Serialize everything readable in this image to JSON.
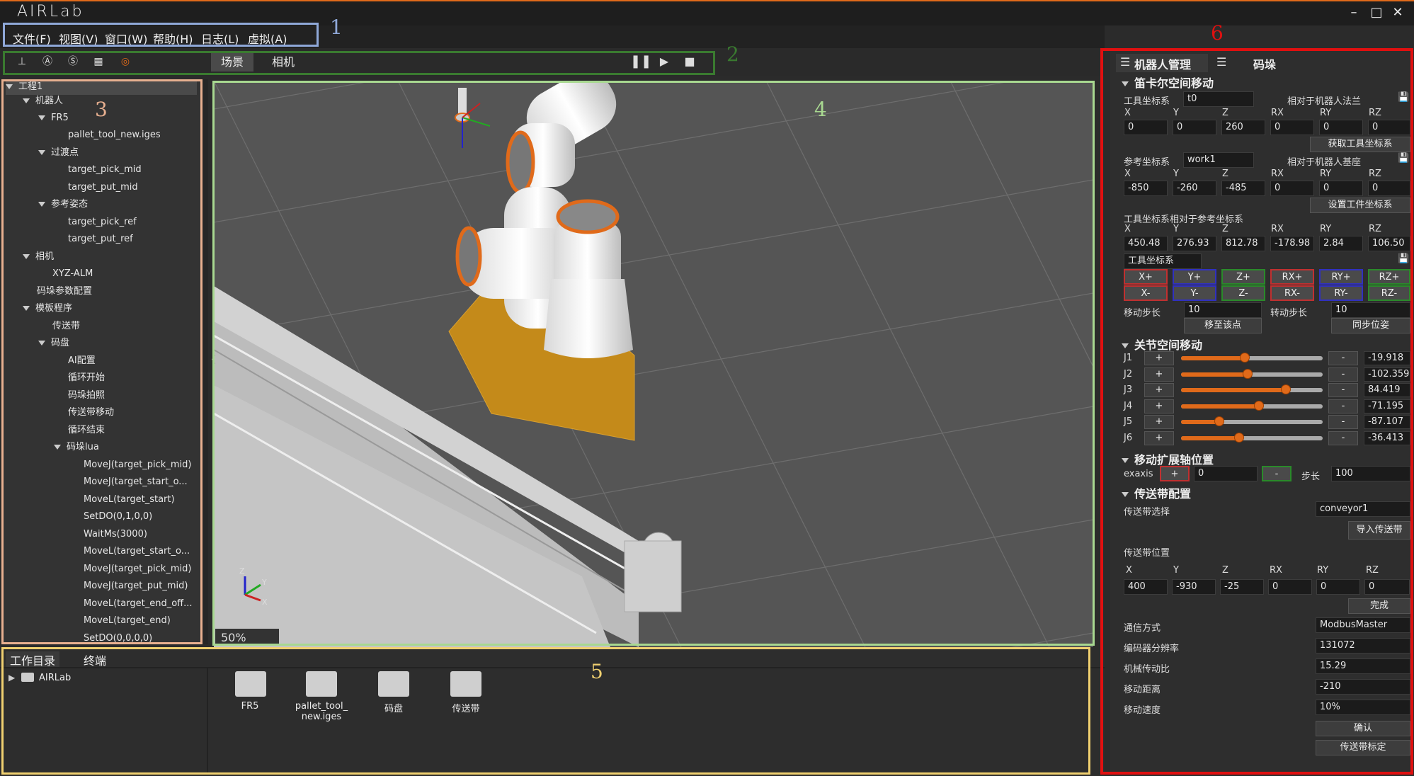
{
  "app": {
    "title": "AIRLab"
  },
  "menu": [
    "文件(F)",
    "视图(V)",
    "窗口(W)",
    "帮助(H)",
    "日志(L)",
    "虚拟(A)"
  ],
  "toolbar": {
    "tabs": [
      "场景",
      "相机"
    ],
    "active_tab": "场景"
  },
  "annotations": {
    "labels": [
      "1",
      "2",
      "3",
      "4",
      "5",
      "6"
    ],
    "colors": {
      "1": "#8fa8d8",
      "2": "#3a7a30",
      "3": "#e8b090",
      "4": "#a8d890",
      "5": "#f0d070",
      "6": "#e01010"
    }
  },
  "tree": {
    "items": [
      {
        "label": "工程1",
        "expanded": true
      },
      {
        "label": "机器人",
        "expanded": true
      },
      {
        "label": "FR5",
        "expanded": true
      },
      {
        "label": "pallet_tool_new.iges"
      },
      {
        "label": "过渡点",
        "expanded": true
      },
      {
        "label": "target_pick_mid"
      },
      {
        "label": "target_put_mid"
      },
      {
        "label": "参考姿态",
        "expanded": true
      },
      {
        "label": "target_pick_ref"
      },
      {
        "label": "target_put_ref"
      },
      {
        "label": "相机",
        "expanded": true
      },
      {
        "label": "XYZ-ALM"
      },
      {
        "label": "码垛参数配置"
      },
      {
        "label": "模板程序",
        "expanded": true
      },
      {
        "label": "传送带"
      },
      {
        "label": "码盘",
        "expanded": true
      },
      {
        "label": "AI配置"
      },
      {
        "label": "循环开始"
      },
      {
        "label": "码垛拍照"
      },
      {
        "label": "传送带移动"
      },
      {
        "label": "循环结束"
      },
      {
        "label": "码垛lua",
        "expanded": true
      },
      {
        "label": "MoveJ(target_pick_mid)"
      },
      {
        "label": "MoveJ(target_start_o..."
      },
      {
        "label": "MoveL(target_start)"
      },
      {
        "label": "SetDO(0,1,0,0)"
      },
      {
        "label": "WaitMs(3000)"
      },
      {
        "label": "MoveL(target_start_o..."
      },
      {
        "label": "MoveJ(target_pick_mid)"
      },
      {
        "label": "MoveJ(target_put_mid)"
      },
      {
        "label": "MoveL(target_end_off..."
      },
      {
        "label": "MoveL(target_end)"
      },
      {
        "label": "SetDO(0,0,0,0)"
      }
    ]
  },
  "viewport": {
    "zoom": "50%",
    "axes": [
      "Z",
      "Y",
      "X"
    ]
  },
  "bottom": {
    "tabs": [
      "工作目录",
      "终端"
    ],
    "tree_root": "AIRLab",
    "files": [
      "FR5",
      "pallet_tool_\nnew.iges",
      "码盘",
      "传送带"
    ]
  },
  "right": {
    "tabs": [
      "机器人管理",
      "码垛"
    ],
    "cartesian": {
      "title": "笛卡尔空间移动",
      "tool_label": "工具坐标系",
      "tool_value": "t0",
      "tool_rel": "相对于机器人法兰",
      "axes": [
        "X",
        "Y",
        "Z",
        "RX",
        "RY",
        "RZ"
      ],
      "tool_vals": [
        "0",
        "0",
        "260",
        "0",
        "0",
        "0"
      ],
      "get_tool_btn": "获取工具坐标系",
      "ref_label": "参考坐标系",
      "ref_value": "work1",
      "ref_rel": "相对于机器人基座",
      "ref_vals": [
        "-850",
        "-260",
        "-485",
        "0",
        "0",
        "0"
      ],
      "set_work_btn": "设置工件坐标系",
      "tool_in_ref": "工具坐标系相对于参考坐标系",
      "pose_vals": [
        "450.48",
        "276.93",
        "812.78",
        "-178.98",
        "2.84",
        "106.50"
      ],
      "frame_label": "工具坐标系",
      "jog_plus": [
        "X+",
        "Y+",
        "Z+",
        "RX+",
        "RY+",
        "RZ+"
      ],
      "jog_minus": [
        "X-",
        "Y-",
        "Z-",
        "RX-",
        "RY-",
        "RZ-"
      ],
      "move_step_label": "移动步长",
      "move_step": "10",
      "rot_step_label": "转动步长",
      "rot_step": "10",
      "move_to_btn": "移至该点",
      "sync_btn": "同步位姿"
    },
    "joint": {
      "title": "关节空间移动",
      "joints": [
        {
          "name": "J1",
          "value": "-19.918",
          "pos": 0.45
        },
        {
          "name": "J2",
          "value": "-102.359",
          "pos": 0.47
        },
        {
          "name": "J3",
          "value": "84.419",
          "pos": 0.74
        },
        {
          "name": "J4",
          "value": "-71.195",
          "pos": 0.55
        },
        {
          "name": "J5",
          "value": "-87.107",
          "pos": 0.27
        },
        {
          "name": "J6",
          "value": "-36.413",
          "pos": 0.41
        }
      ],
      "plus": "+",
      "minus": "-"
    },
    "ext": {
      "title": "移动扩展轴位置",
      "label": "exaxis",
      "plus": "+",
      "value": "0",
      "minus": "-",
      "step_label": "步长",
      "step": "100"
    },
    "conveyor": {
      "title": "传送带配置",
      "select_label": "传送带选择",
      "select_value": "conveyor1",
      "import_btn": "导入传送带",
      "pos_label": "传送带位置",
      "axes": [
        "X",
        "Y",
        "Z",
        "RX",
        "RY",
        "RZ"
      ],
      "pos_vals": [
        "400",
        "-930",
        "-25",
        "0",
        "0",
        "0"
      ],
      "done_btn": "完成",
      "comm_label": "通信方式",
      "comm_value": "ModbusMaster",
      "enc_label": "编码器分辨率",
      "enc_value": "131072",
      "ratio_label": "机械传动比",
      "ratio_value": "15.29",
      "dist_label": "移动距离",
      "dist_value": "-210",
      "speed_label": "移动速度",
      "speed_value": "10%",
      "confirm_btn": "确认",
      "calib_btn": "传送带标定"
    }
  }
}
